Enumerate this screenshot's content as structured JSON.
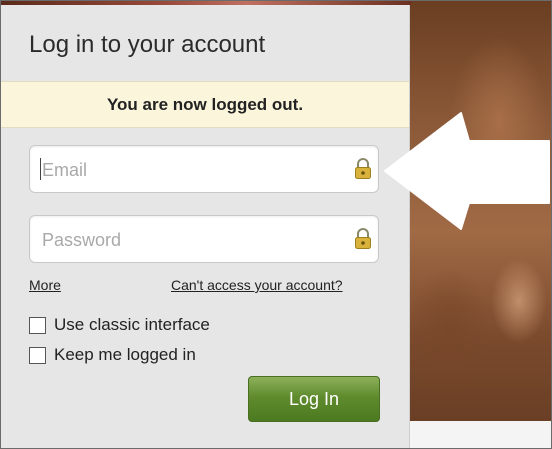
{
  "login": {
    "title": "Log in to your account",
    "banner": "You are now logged out.",
    "email_placeholder": "Email",
    "password_placeholder": "Password",
    "more_link": "More",
    "cant_access_link": "Can't access your account?",
    "classic_label": "Use classic interface",
    "keep_label": "Keep me logged in",
    "login_button": "Log In"
  },
  "colors": {
    "banner_bg": "#fbf5dc",
    "button_green": "#5f8b2d",
    "lock_gold": "#c9a227"
  },
  "icons": {
    "field_lock": "lock-icon",
    "pointer": "arrow-left-icon"
  }
}
